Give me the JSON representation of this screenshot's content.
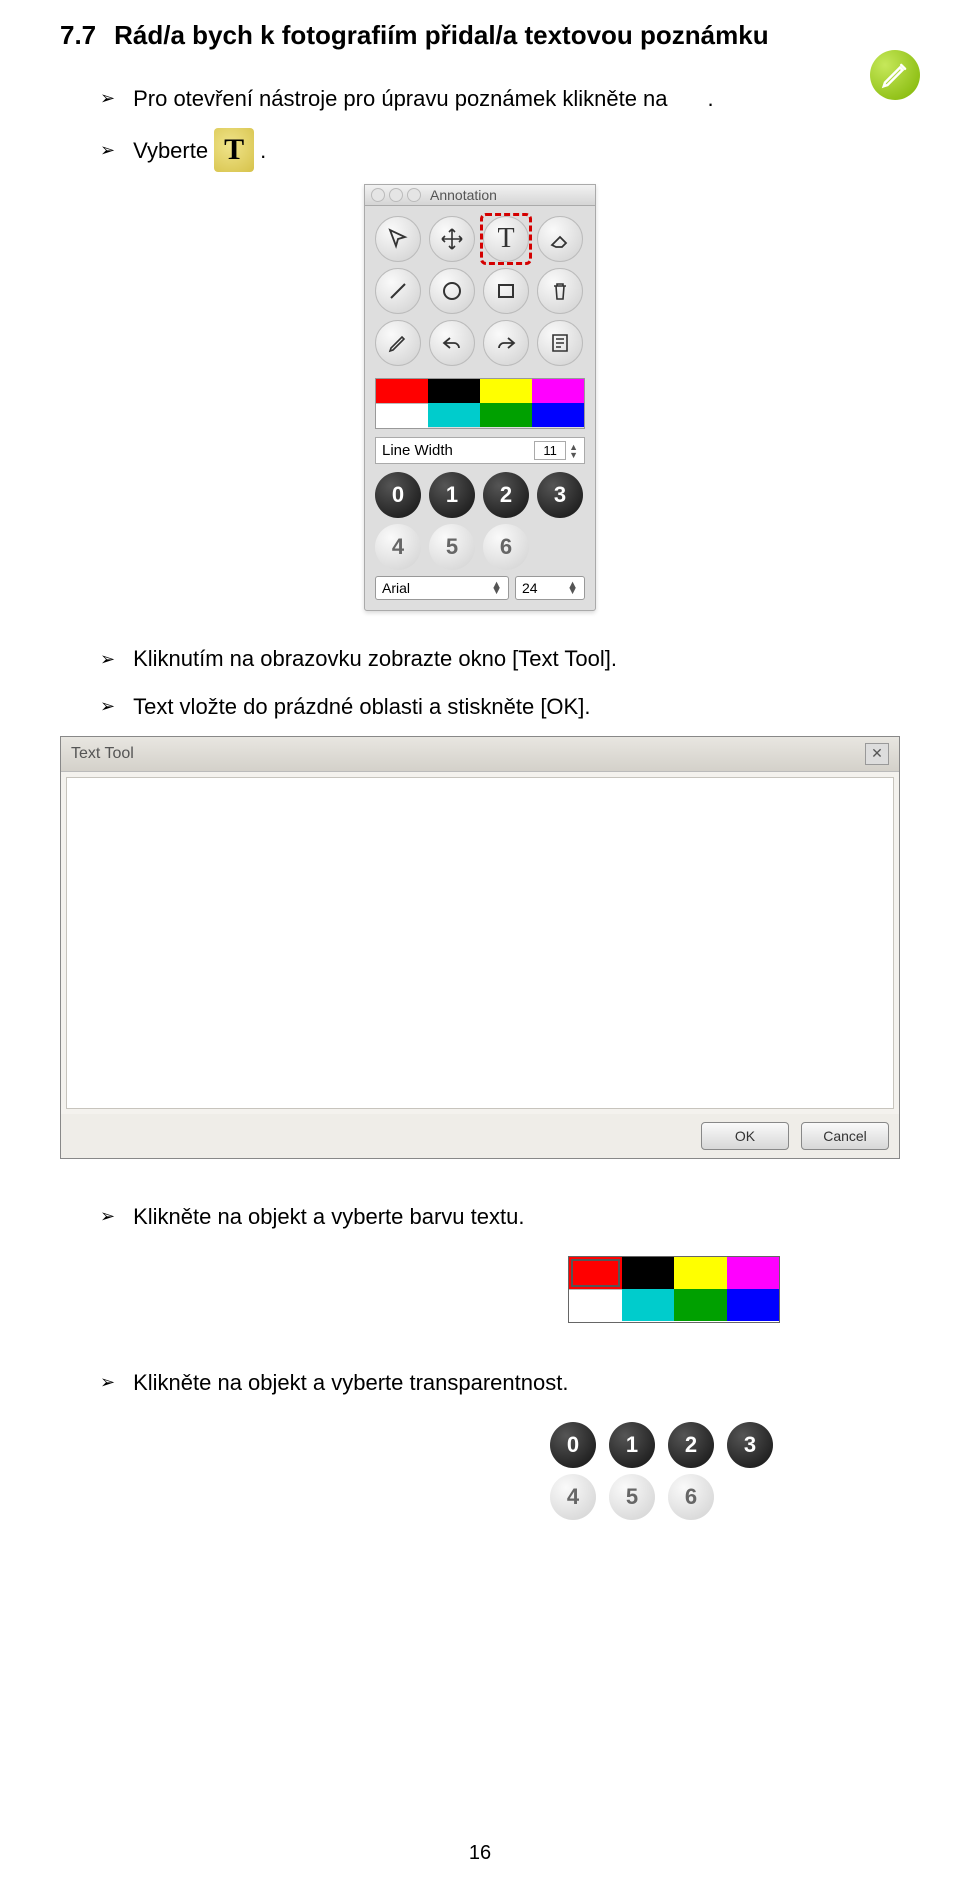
{
  "heading": {
    "num": "7.7",
    "text": "Rád/a bych k fotografiím přidal/a textovou poznámku"
  },
  "bullets": {
    "b1a": "Pro otevření nástroje pro úpravu poznámek klikněte na",
    "b1b": ".",
    "b2a": "Vyberte",
    "b2b": ".",
    "b3": "Kliknutím na obrazovku zobrazte okno [Text Tool].",
    "b4": "Text vložte do prázdné oblasti a stiskněte [OK].",
    "b5": "Klikněte na objekt a vyberte barvu textu.",
    "b6": "Klikněte na objekt a vyberte transparentnost."
  },
  "annotation_panel": {
    "title": "Annotation",
    "t_glyph": "T",
    "linewidth_label": "Line Width",
    "linewidth_value": "11",
    "numbers": [
      "0",
      "1",
      "2",
      "3",
      "4",
      "5",
      "6"
    ],
    "font_name": "Arial",
    "font_size": "24"
  },
  "colors": {
    "red": "#ff0000",
    "black": "#000000",
    "yellow": "#ffff00",
    "magenta": "#ff00ff",
    "white": "#ffffff",
    "cyan": "#00cccc",
    "green": "#00a000",
    "blue": "#0000ff"
  },
  "text_tool": {
    "title": "Text Tool",
    "ok": "OK",
    "cancel": "Cancel",
    "close": "✕"
  },
  "page_number": "16"
}
